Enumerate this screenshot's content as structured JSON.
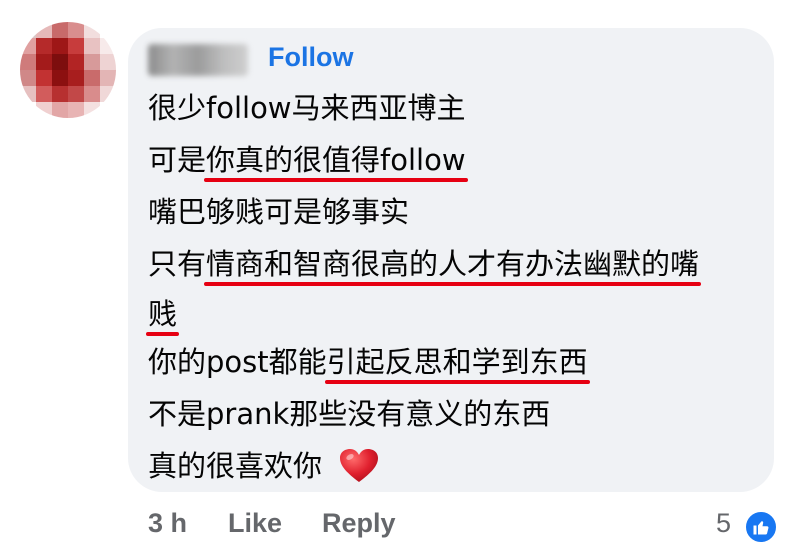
{
  "comment": {
    "follow_label": "Follow",
    "lines": [
      {
        "pre": "很少follow马来西亚博主",
        "u": "",
        "post": ""
      },
      {
        "pre": "可是",
        "u": "你真的很值得follow",
        "post": ""
      },
      {
        "pre": "嘴巴够贱可是够事实",
        "u": "",
        "post": ""
      },
      {
        "pre": "只有",
        "u": "情商和智商很高的人才有办法幽默的嘴",
        "post": ""
      },
      {
        "pre": "",
        "u": "贱",
        "post": ""
      },
      {
        "pre": "你的post都能",
        "u": "引起反思和学到东西",
        "post": ""
      },
      {
        "pre": "不是prank那些没有意义的东西",
        "u": "",
        "post": ""
      },
      {
        "pre": "真的很喜欢你",
        "u": "",
        "post": ""
      }
    ],
    "heart_icon": "red-heart-emoji",
    "accent_color": "#1b74e4",
    "underline_color": "#e60012"
  },
  "footer": {
    "time": "3 h",
    "like_label": "Like",
    "reply_label": "Reply",
    "reaction_count": "5",
    "reaction_icon": "thumbs-up-icon"
  }
}
